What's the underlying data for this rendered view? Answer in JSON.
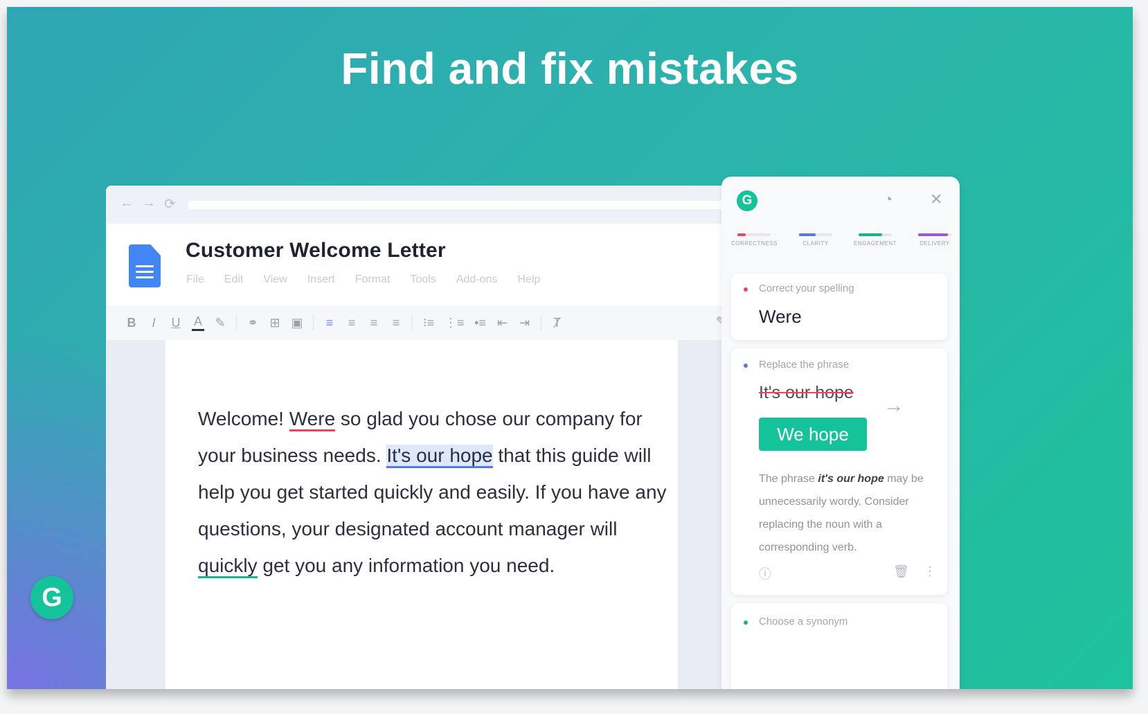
{
  "headline": "Find and fix mistakes",
  "browser": {
    "nav": {
      "back": "←",
      "forward": "→",
      "reload": "⟳"
    },
    "doc": {
      "title": "Customer Welcome Letter",
      "menu": [
        "File",
        "Edit",
        "View",
        "Insert",
        "Format",
        "Tools",
        "Add-ons",
        "Help"
      ],
      "text": {
        "s1": "Welcome! ",
        "err_spelling": "Were",
        "s2": " so glad you chose our company for your business needs. ",
        "err_phrase": "It's our hope",
        "s3": " that this guide will help you get started quickly and easily. If you have any questions, your designated account manager will ",
        "err_synonym": "quickly",
        "s4": " get you any information you need."
      }
    },
    "toolbar": [
      "B",
      "I",
      "U",
      "A",
      "✎",
      "⚭",
      "⊞",
      "▣",
      "≡",
      "≡",
      "≡",
      "≡",
      "⁝≡",
      "⋮≡",
      "•≡",
      "⇤",
      "⇥",
      "Ⱦ"
    ]
  },
  "panel": {
    "logo": "G",
    "categories": [
      {
        "label": "CORRECTNESS",
        "color": "#e8475d",
        "fill": 0.25
      },
      {
        "label": "CLARITY",
        "color": "#5479e0",
        "fill": 0.5
      },
      {
        "label": "ENGAGEMENT",
        "color": "#18b48b",
        "fill": 0.7
      },
      {
        "label": "DELIVERY",
        "color": "#9b59d6",
        "fill": 0.9
      }
    ],
    "cards": {
      "spelling": {
        "title": "Correct your spelling",
        "suggestion": "Were"
      },
      "phrase": {
        "title": "Replace the phrase",
        "original": "It's our hope",
        "replacement": "We hope",
        "expl_pre": "The phrase ",
        "expl_bold": "it's our hope",
        "expl_post": " may be unnecessarily wordy. Consider replacing the noun with a corresponding verb."
      },
      "synonym": {
        "title": "Choose a synonym"
      }
    }
  },
  "float_logo": "G",
  "colors": {
    "grammarly_green": "#15c39a",
    "error_red": "#e8475d",
    "clarity_blue": "#5479e0",
    "delivery_purple": "#9b59d6"
  }
}
